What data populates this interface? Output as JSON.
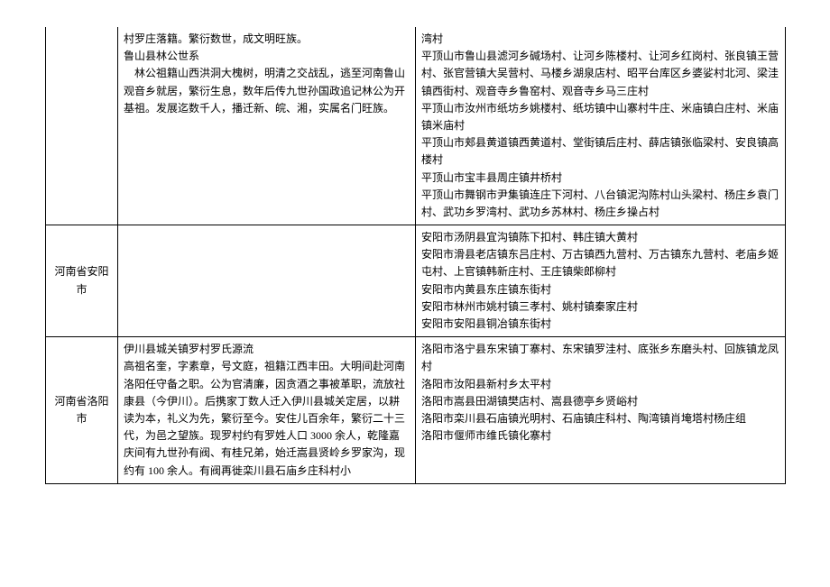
{
  "row1": {
    "col1": "",
    "col2_p1": "村罗庄落籍。繁衍数世，成文明旺族。",
    "col2_p2": "鲁山县林公世系",
    "col2_p3": "林公祖籍山西洪洞大槐树，明清之交战乱，逃至河南鲁山观音乡就居，繁衍生息，数年后传九世孙国政追记林公为开基祖。发展迄数千人，播迁新、皖、湘，实属名门旺族。",
    "col3_p1": "湾村",
    "col3_p2": "平顶山市鲁山县滤河乡碱场村、让河乡陈楼村、让河乡红岗村、张良镇王营村、张官营镇大吴营村、马楼乡湖泉店村、昭平台库区乡婆娑村北河、梁洼镇西街村、观音寺乡鲁窑村、观音寺乡马三庄村",
    "col3_p3": "平顶山市汝州市纸坊乡姚楼村、纸坊镇中山寨村牛庄、米庙镇白庄村、米庙镇米庙村",
    "col3_p4": "平顶山市郏县黄道镇西黄道村、堂街镇后庄村、薛店镇张临梁村、安良镇高楼村",
    "col3_p5": "平顶山市宝丰县周庄镇井桥村",
    "col3_p6": "平顶山市舞钢市尹集镇连庄下河村、八台镇泥沟陈村山头梁村、杨庄乡袁门村、武功乡罗湾村、武功乡苏林村、杨庄乡操占村"
  },
  "row2": {
    "region": "河南省安阳市",
    "col2": "",
    "col3_p1": "安阳市汤阴县宜沟镇陈下扣村、韩庄镇大黄村",
    "col3_p2": "安阳市滑县老店镇东吕庄村、万古镇西九营村、万古镇东九营村、老庙乡姬屯村、上官镇韩新庄村、王庄镇柴郎柳村",
    "col3_p3": "安阳市内黄县东庄镇东街村",
    "col3_p4": "安阳市林州市姚村镇三孝村、姚村镇秦家庄村",
    "col3_p5": "安阳市安阳县铜冶镇东街村"
  },
  "row3": {
    "region": "河南省洛阳市",
    "col2_p1": "伊川县城关镇罗村罗氏源流",
    "col2_p2": "高祖名奎，字素章，号文庭，祖籍江西丰田。大明间赴河南洛阳任守备之职。公为官清廉，因贪酒之事被革职，流放社康县（今伊川）。后携家丁数人迁入伊川县城关定居，以耕读为本，礼义为先，繁衍至今。安住儿百余年，繁衍二十三代，为邑之望族。现罗村约有罗姓人口 3000 余人，乾隆嘉庆间有九世孙有阀、有桂兄弟，始迁嵩县贤岭乡罗家沟，现约有 100 余人。有阀再徙栾川县石庙乡庄科村小",
    "col3_p1": "洛阳市洛宁县东宋镇丁寨村、东宋镇罗洼村、底张乡东磨头村、回族镇龙凤村",
    "col3_p2": "洛阳市汝阳县新村乡太平村",
    "col3_p3": "洛阳市嵩县田湖镇樊店村、嵩县德亭乡贤峪村",
    "col3_p4": "洛阳市栾川县石庙镇光明村、石庙镇庄科村、陶湾镇肖埯塔村杨庄组",
    "col3_p5": "洛阳市偃师市维氏镇化寨村"
  }
}
